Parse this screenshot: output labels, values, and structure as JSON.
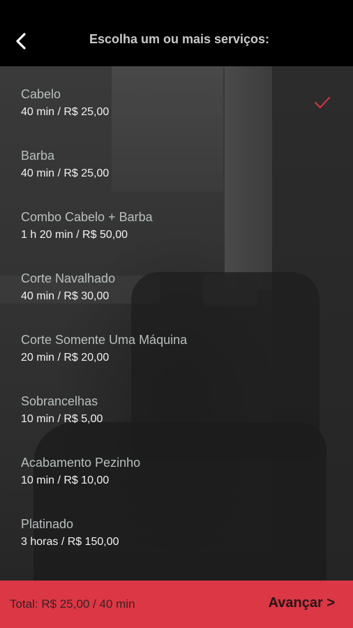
{
  "header": {
    "title": "Escolha um ou mais serviços:",
    "back_icon": "chevron-left-icon"
  },
  "services": [
    {
      "name": "Cabelo",
      "detail": "40 min / R$ 25,00",
      "selected": true
    },
    {
      "name": "Barba",
      "detail": "40 min / R$ 25,00",
      "selected": false
    },
    {
      "name": "Combo Cabelo + Barba",
      "detail": "1 h 20 min / R$ 50,00",
      "selected": false
    },
    {
      "name": "Corte Navalhado",
      "detail": "40 min / R$ 30,00",
      "selected": false
    },
    {
      "name": "Corte Somente Uma Máquina",
      "detail": "20 min / R$ 20,00",
      "selected": false
    },
    {
      "name": "Sobrancelhas",
      "detail": "10 min / R$ 5,00",
      "selected": false
    },
    {
      "name": "Acabamento Pezinho",
      "detail": "10 min / R$ 10,00",
      "selected": false
    },
    {
      "name": "Platinado",
      "detail": "3 horas / R$ 150,00",
      "selected": false
    }
  ],
  "footer": {
    "total": "Total: R$ 25,00 / 40 min",
    "advance_label": "Avançar >"
  },
  "colors": {
    "accent": "#dc3745",
    "header_bg": "#000000",
    "check": "#dc3745"
  }
}
